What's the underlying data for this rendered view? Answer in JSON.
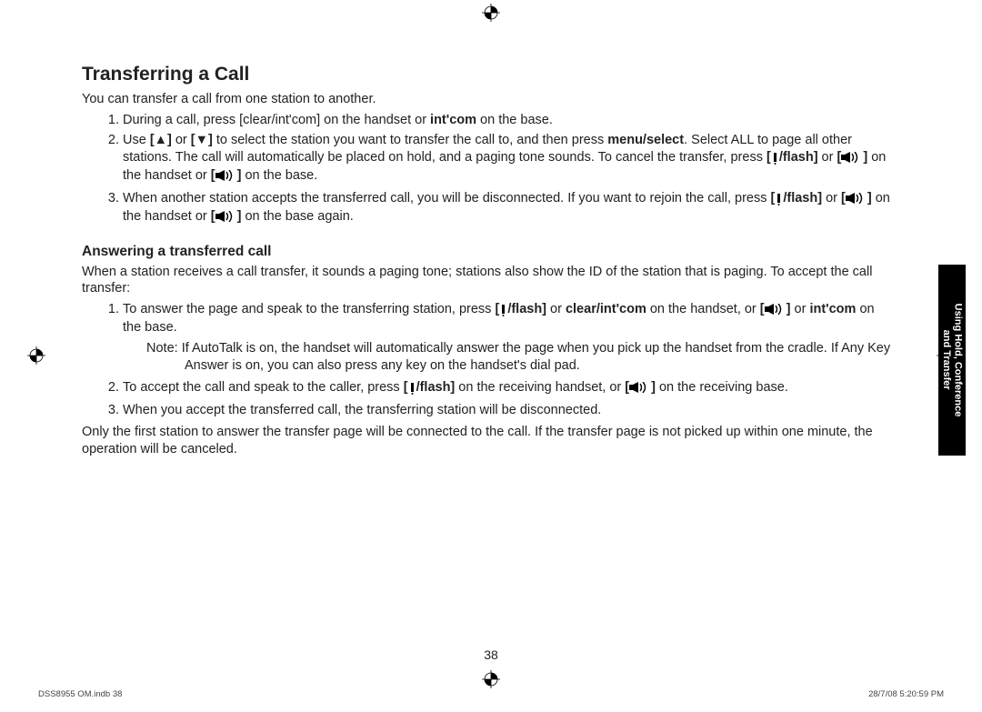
{
  "heading": "Transferring a Call",
  "intro": "You can transfer a call from one station to another.",
  "steps": [
    {
      "pre": "During a call, press [clear/int'com] on the handset or ",
      "bold1": "int'com",
      "post": " on the base."
    },
    {
      "pre": "Use ",
      "mid1": " or ",
      "mid2": " to select the station you want to transfer the call to, and then press ",
      "bold1": "menu/select",
      "post1": ". Select ALL to page all other stations. The call will automatically be placed on hold, and a paging tone sounds. To cancel the transfer, press ",
      "bold2": "/flash]",
      "mid3": " or ",
      "mid4": " on the handset or ",
      "post2": " on the base."
    },
    {
      "pre": "When another station accepts the transferred call, you will be disconnected. If you want to rejoin the call, press ",
      "bold1": "/flash]",
      "mid1": " or ",
      "mid2": " on the handset or ",
      "post": " on the base again."
    }
  ],
  "sub_heading": "Answering a transferred call",
  "sub_intro": "When a station receives a call transfer, it sounds a paging tone; stations also show the ID of the station that is paging. To accept the call transfer:",
  "sub_steps": [
    {
      "pre": "To answer the page and speak to the transferring station, press ",
      "bold1": "/flash]",
      "mid1": " or ",
      "bold2": "clear/int'com",
      "mid2": " on the handset, or ",
      "mid3": " or ",
      "bold3": "int'com",
      "post": " on the base."
    },
    {
      "pre": "To accept the call and speak to the caller, press ",
      "bold1": "/flash]",
      "mid1": " on the receiving handset, or ",
      "post": " on the receiving base."
    },
    {
      "text": "When you accept the transferred call, the transferring station will be disconnected."
    }
  ],
  "note_label": "Note:",
  "note_text": "  If AutoTalk is on, the handset will automatically answer the page when you pick up the handset from the cradle. If Any Key Answer is on, you can also press any key on the handset's dial pad.",
  "outro": "Only the first station to answer the transfer page will be connected to the call. If the transfer page is not picked up within one minute, the operation will be canceled.",
  "tab_line1": "Using Hold, Conference",
  "tab_line2": "and Transfer",
  "page_number": "38",
  "footer_left": "DSS8955 OM.indb   38",
  "footer_right": "28/7/08   5:20:59 PM",
  "icons": {
    "up": "[▲]",
    "down": "[▼]",
    "speaker_open": "[",
    "speaker_close": "]",
    "flash_open": "["
  }
}
